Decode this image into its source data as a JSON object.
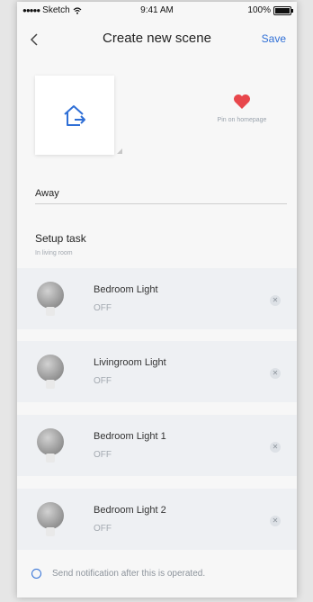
{
  "status_bar": {
    "carrier": "Sketch",
    "time": "9:41 AM",
    "battery": "100%"
  },
  "nav": {
    "back_icon": "chevron-left-icon",
    "title": "Create new scene",
    "save_label": "Save"
  },
  "scene": {
    "icon": "home-exit-icon",
    "pin_icon": "heart-icon",
    "pin_color": "#e8474c",
    "pin_label": "Pin on homepage",
    "name_value": "Away"
  },
  "setup": {
    "title": "Setup task",
    "subtitle": "In living room"
  },
  "devices": [
    {
      "name": "Bedroom Light",
      "state": "OFF"
    },
    {
      "name": "Livingroom Light",
      "state": "OFF"
    },
    {
      "name": "Bedroom Light 1",
      "state": "OFF"
    },
    {
      "name": "Bedroom Light 2",
      "state": "OFF"
    }
  ],
  "notification": {
    "label": "Send notification after this is operated."
  },
  "colors": {
    "accent": "#2f6fd6",
    "heart": "#e8474c"
  }
}
